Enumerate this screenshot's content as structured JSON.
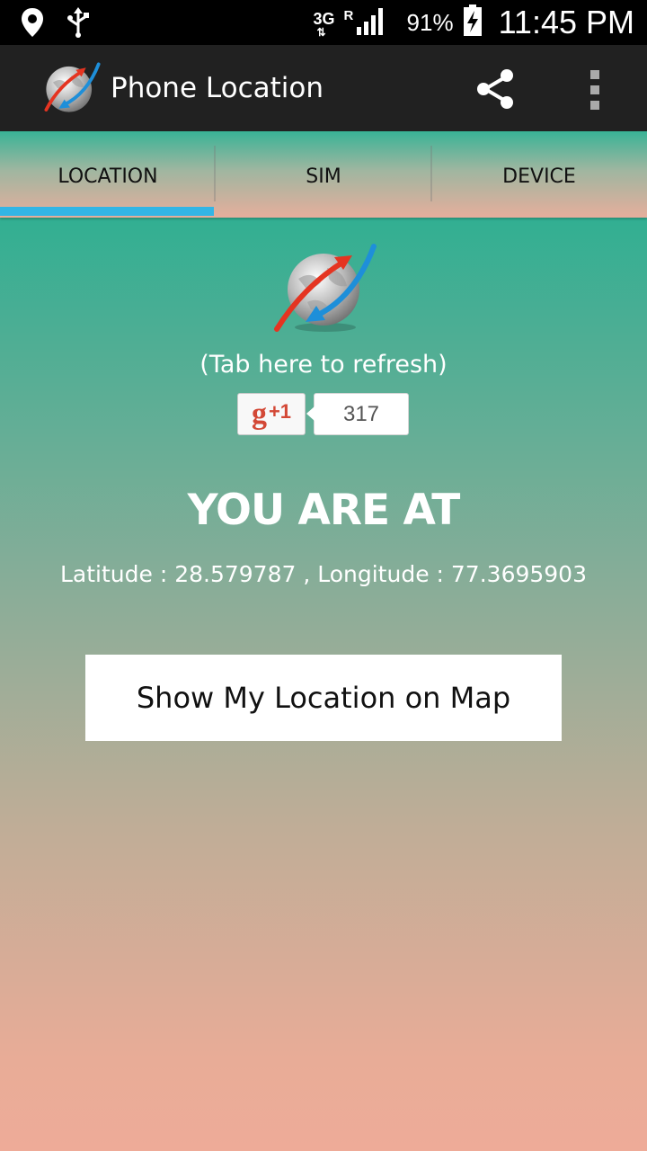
{
  "status_bar": {
    "network_type": "3G",
    "roaming": "R",
    "battery_percent": "91%",
    "time": "11:45 PM",
    "icons": [
      "location-pin-icon",
      "usb-icon",
      "data-arrows-icon",
      "signal-icon",
      "battery-charging-icon"
    ]
  },
  "action_bar": {
    "title": "Phone Location",
    "icons": [
      "app-logo-icon",
      "share-icon",
      "overflow-menu-icon"
    ]
  },
  "tabs": [
    {
      "label": "LOCATION",
      "selected": true
    },
    {
      "label": "SIM",
      "selected": false
    },
    {
      "label": "DEVICE",
      "selected": false
    }
  ],
  "main": {
    "refresh_hint": "(Tab here to refresh)",
    "gplus": {
      "label": "+1",
      "count": "317"
    },
    "heading": "YOU ARE AT",
    "coordinates": "Latitude : 28.579787 , Longitude : 77.3695903",
    "map_button": "Show My Location on Map"
  },
  "colors": {
    "action_bar": "#212121",
    "tab_indicator": "#33b5e5",
    "gradient_top": "#2faf92",
    "gradient_bottom": "#eeab98",
    "gplus_red": "#d34836"
  }
}
